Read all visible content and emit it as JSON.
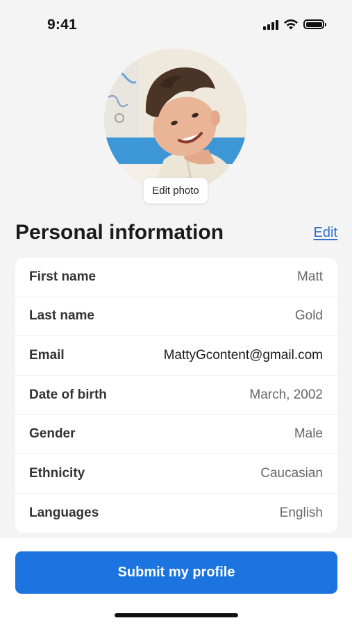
{
  "status_bar": {
    "time": "9:41"
  },
  "profile": {
    "edit_photo_label": "Edit photo"
  },
  "section": {
    "title": "Personal information",
    "edit_label": "Edit"
  },
  "fields": [
    {
      "label": "First name",
      "value": "Matt"
    },
    {
      "label": "Last name",
      "value": "Gold"
    },
    {
      "label": "Email",
      "value": "MattyGcontent@gmail.com"
    },
    {
      "label": "Date of birth",
      "value": "March, 2002"
    },
    {
      "label": "Gender",
      "value": "Male"
    },
    {
      "label": "Ethnicity",
      "value": "Caucasian"
    },
    {
      "label": "Languages",
      "value": "English"
    }
  ],
  "footer": {
    "submit_label": "Submit my profile"
  },
  "colors": {
    "accent": "#1b74e0",
    "link": "#2f6fcf",
    "background": "#f4f4f4"
  }
}
